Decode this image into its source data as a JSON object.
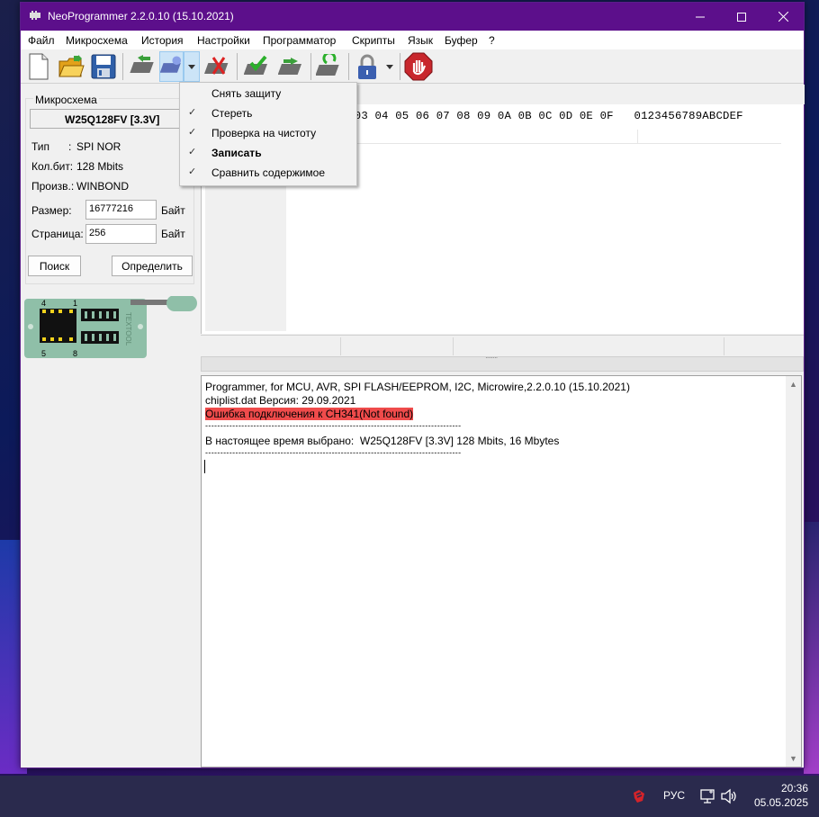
{
  "window": {
    "title": "NeoProgrammer 2.2.0.10 (15.10.2021)"
  },
  "menu": [
    "Файл",
    "Микросхема",
    "История",
    "Настройки",
    "Программатор",
    "Скрипты",
    "Язык",
    "Буфер",
    "?"
  ],
  "toolbar": {
    "icons": [
      "new-file-icon",
      "open-folder-icon",
      "save-disk-icon",
      "read-chip-icon",
      "operations-chip-icon",
      "dropdown-arrow-icon",
      "erase-chip-icon",
      "verify-chip-icon",
      "write-chip-icon",
      "blank-check-chip-icon",
      "lock-icon",
      "stop-icon"
    ]
  },
  "chip_panel": {
    "group_title": "Микросхема",
    "chip_name": "W25Q128FV [3.3V]",
    "type_label": "Тип",
    "type_sep": ":",
    "type_value": "SPI NOR",
    "bits_label": "Кол.бит:",
    "bits_value": "128 Mbits",
    "manuf_label": "Произв.:",
    "manuf_value": "WINBOND",
    "size_label": "Размер:",
    "size_value": "16777216",
    "size_unit": "Байт",
    "page_label": "Страница:",
    "page_value": "256",
    "page_unit": "Байт",
    "search_button": "Поиск",
    "detect_button": "Определить"
  },
  "socket": {
    "pin_top_left": "4",
    "pin_top_right": "1",
    "pin_bottom_left": "5",
    "pin_bottom_right": "8",
    "brand": "TEXTOOL"
  },
  "hex": {
    "header": "02 03 04 05 06 07 08 09 0A 0B 0C 0D 0E 0F   0123456789ABCDEF"
  },
  "dropdown": {
    "items": [
      {
        "label": "Снять защиту",
        "checked": false,
        "bold": false
      },
      {
        "label": "Стереть",
        "checked": true,
        "bold": false
      },
      {
        "label": "Проверка на чистоту",
        "checked": true,
        "bold": false
      },
      {
        "label": "Записать",
        "checked": true,
        "bold": true
      },
      {
        "label": "Сравнить содержимое",
        "checked": true,
        "bold": false
      }
    ],
    "check_glyph": "✓"
  },
  "log": {
    "lines": [
      "Programmer, for MCU, AVR, SPI FLASH/EEPROM, I2C, Microwire,2.2.0.10 (15.10.2021)",
      "chiplist.dat Версия: 29.09.2021",
      "Ошибка подключения к CH341(Not found)",
      "-------------------------------------------------------------------------------------",
      "В настоящее время выбрано:  W25Q128FV [3.3V] 128 Mbits, 16 Mbytes",
      "-------------------------------------------------------------------------------------"
    ],
    "error_color": "#ef4b4b"
  },
  "taskbar": {
    "lang": "РУС",
    "time": "20:36",
    "date": "05.05.2025"
  },
  "colors": {
    "titlebar": "#5c0f8b",
    "taskbar": "#2a2a4d",
    "socket_green": "#8fbfa8"
  }
}
